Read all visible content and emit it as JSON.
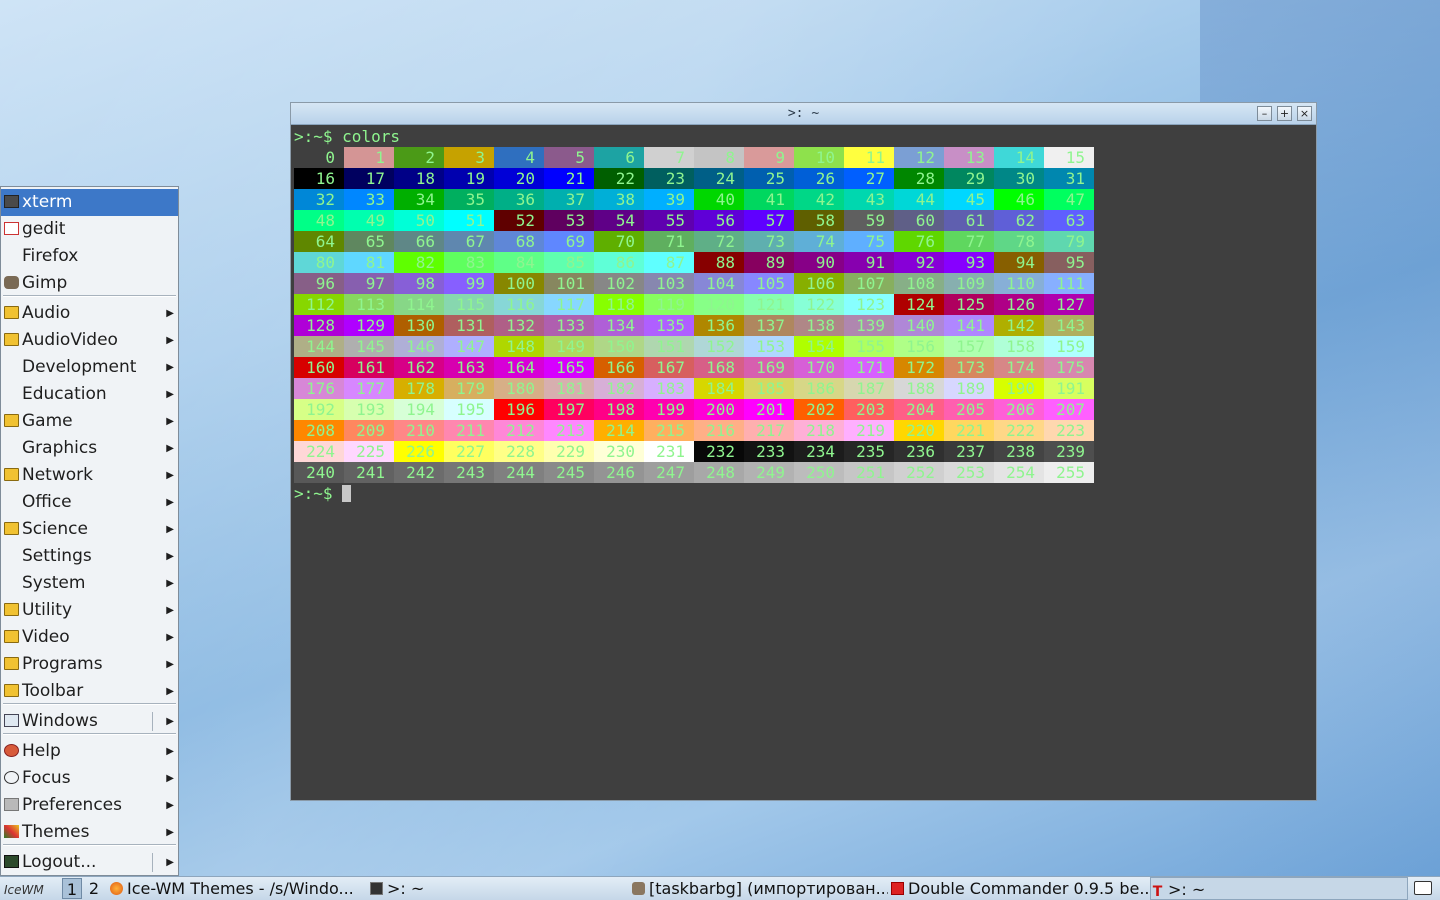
{
  "terminal": {
    "title": ">: ~",
    "prompt": ">:~$",
    "command": "colors",
    "buttons": {
      "minimize": "–",
      "maximize": "+",
      "close": "×"
    },
    "xterm_palette": [
      "#000000",
      "#cd0000",
      "#00cd00",
      "#cdcd00",
      "#0000ee",
      "#cd00cd",
      "#00cdcd",
      "#e5e5e5",
      "#7f7f7f",
      "#ff0000",
      "#00ff00",
      "#ffff00",
      "#5c5cff",
      "#ff00ff",
      "#00ffff",
      "#ffffff"
    ],
    "base_colors": [
      "#3f3f3f",
      "#d49595",
      "#4b9a17",
      "#c6a200",
      "#2f6fbf",
      "#8b5a8c",
      "#1da3a3",
      "#d0d0d0",
      "#c4c4c4",
      "#d99a9a",
      "#8ee14c",
      "#ffff3f",
      "#7b9fd4",
      "#c88fc6",
      "#3fd8d8",
      "#f0f0f0"
    ]
  },
  "menu": {
    "items": [
      {
        "label": "xterm",
        "icon": "terminal-icon",
        "submenu": false,
        "selected": true
      },
      {
        "label": "gedit",
        "icon": "gedit-icon",
        "submenu": false
      },
      {
        "label": "Firefox",
        "icon": "",
        "submenu": false
      },
      {
        "label": "Gimp",
        "icon": "gimp-icon",
        "submenu": false
      },
      {
        "label": "Audio",
        "icon": "folder-icon",
        "submenu": true
      },
      {
        "label": "AudioVideo",
        "icon": "folder-icon",
        "submenu": true
      },
      {
        "label": "Development",
        "icon": "",
        "submenu": true
      },
      {
        "label": "Education",
        "icon": "",
        "submenu": true
      },
      {
        "label": "Game",
        "icon": "folder-icon",
        "submenu": true
      },
      {
        "label": "Graphics",
        "icon": "",
        "submenu": true
      },
      {
        "label": "Network",
        "icon": "folder-icon",
        "submenu": true
      },
      {
        "label": "Office",
        "icon": "",
        "submenu": true
      },
      {
        "label": "Science",
        "icon": "folder-icon",
        "submenu": true
      },
      {
        "label": "Settings",
        "icon": "",
        "submenu": true
      },
      {
        "label": "System",
        "icon": "",
        "submenu": true
      },
      {
        "label": "Utility",
        "icon": "folder-icon",
        "submenu": true
      },
      {
        "label": "Video",
        "icon": "folder-icon",
        "submenu": true
      },
      {
        "label": "Programs",
        "icon": "folder-icon",
        "submenu": true
      },
      {
        "label": "Toolbar",
        "icon": "folder-icon",
        "submenu": true
      },
      {
        "label": "Windows",
        "icon": "windows-icon",
        "submenu": true
      },
      {
        "label": "Help",
        "icon": "help-icon",
        "submenu": true
      },
      {
        "label": "Focus",
        "icon": "focus-icon",
        "submenu": true
      },
      {
        "label": "Preferences",
        "icon": "preferences-icon",
        "submenu": true
      },
      {
        "label": "Themes",
        "icon": "themes-icon",
        "submenu": true
      },
      {
        "label": "Logout...",
        "icon": "logout-icon",
        "submenu": true
      }
    ]
  },
  "taskbar": {
    "start_label": "IceWM",
    "workspaces": [
      "1",
      "2"
    ],
    "active_workspace": "1",
    "tasks": [
      {
        "label": "Ice-WM Themes - /s/Windo...",
        "icon": "firefox-icon"
      },
      {
        "label": ">: ~",
        "icon": "terminal-icon"
      },
      {
        "label": "[taskbarbg] (импортирован...",
        "icon": "gimp-icon"
      },
      {
        "label": "Double Commander 0.9.5 be...",
        "icon": "doublecmd-icon"
      },
      {
        "label": ">: ~",
        "icon": "xterm-icon"
      }
    ],
    "tray_icon": "book-icon"
  }
}
